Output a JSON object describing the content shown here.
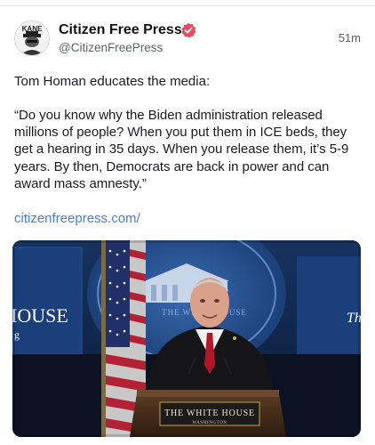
{
  "post": {
    "author_name": "Citizen Free Press",
    "handle": "@CitizenFreePress",
    "timestamp": "51m",
    "avatar_text": "KANE",
    "paragraph_1": "Tom Homan educates the media:",
    "paragraph_2": "“Do you know why the Biden administration released millions of people? When you put them in ICE beds, they get a hearing in 35 days. When you release them, it’s 5-9 years. By then, Democrats are back in power and can award mass amnesty.”",
    "link_text": "citizenfreepress.com/",
    "media": {
      "podium_title": "THE WHITE HOUSE",
      "podium_subtitle": "WASHINGTON",
      "backdrop_text": "THE WHITE HOUSE",
      "left_screen_text": "IOUSE",
      "left_screen_sub": "g",
      "right_screen_text": "Th"
    }
  },
  "colors": {
    "link": "#4d7ed7",
    "verified_badge": "#e84a5f",
    "backdrop_blue": "#1e4a8c"
  }
}
